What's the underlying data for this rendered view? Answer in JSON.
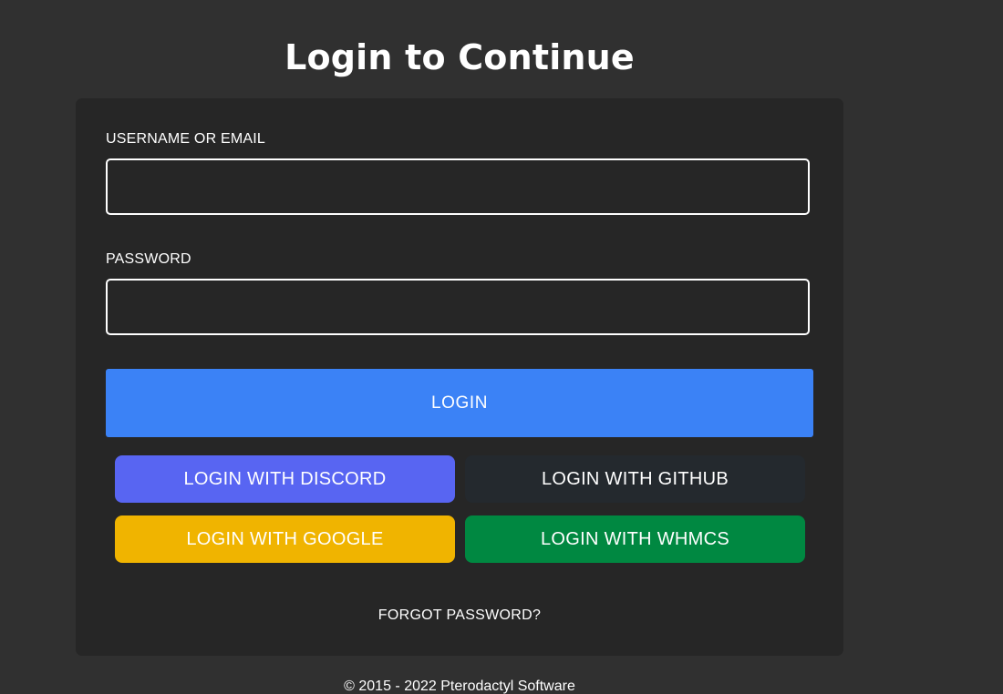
{
  "page": {
    "title": "Login to Continue"
  },
  "form": {
    "username_label": "USERNAME OR EMAIL",
    "username_value": "",
    "username_placeholder": "",
    "password_label": "PASSWORD",
    "password_value": "",
    "password_placeholder": "",
    "login_button": "LOGIN",
    "forgot_link": "FORGOT PASSWORD?"
  },
  "sso": {
    "discord": {
      "label": "LOGIN WITH DISCORD",
      "color": "#5865f2"
    },
    "github": {
      "label": "LOGIN WITH GITHUB",
      "color": "#24292e"
    },
    "google": {
      "label": "LOGIN WITH GOOGLE",
      "color": "#f0b400"
    },
    "whmcs": {
      "label": "LOGIN WITH WHMCS",
      "color": "#008841"
    }
  },
  "footer": {
    "copyright": "© 2015 - 2022 Pterodactyl Software"
  },
  "colors": {
    "background": "#303030",
    "card": "#262626",
    "primary": "#3b82f6",
    "text": "#ffffff"
  }
}
